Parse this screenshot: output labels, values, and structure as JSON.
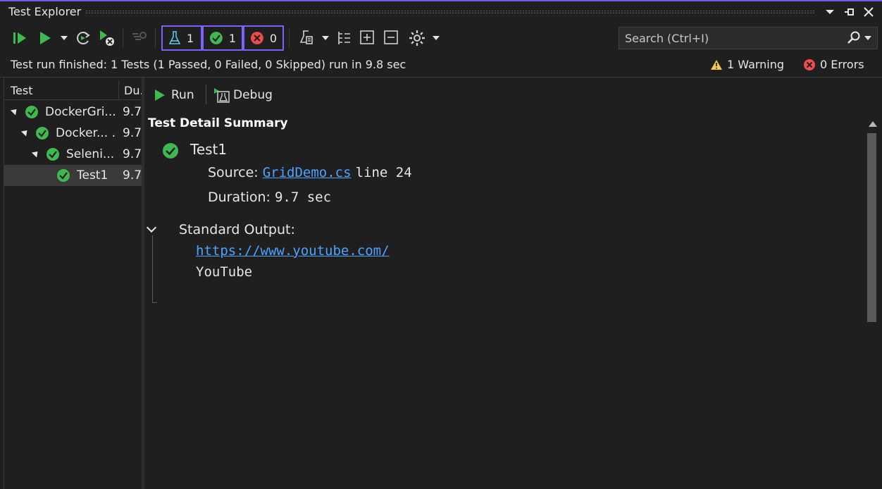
{
  "window": {
    "title": "Test Explorer"
  },
  "toolbar": {
    "counters": [
      {
        "icon": "flask-icon",
        "value": "1"
      },
      {
        "icon": "passed-icon",
        "value": "1"
      },
      {
        "icon": "failed-icon",
        "value": "0"
      }
    ],
    "search_placeholder": "Search (Ctrl+I)"
  },
  "status": {
    "message": "Test run finished: 1 Tests (1 Passed, 0 Failed, 0 Skipped) run in 9.8 sec",
    "warnings": "1 Warning",
    "errors": "0 Errors"
  },
  "tree": {
    "headers": {
      "test": "Test",
      "duration": "Du."
    },
    "rows": [
      {
        "name": "DockerGri...",
        "duration": "9.7",
        "level": 0,
        "selected": false
      },
      {
        "name": "Docker... .",
        "duration": "9.7",
        "level": 1,
        "selected": false
      },
      {
        "name": "Seleni...",
        "duration": "9.7",
        "level": 2,
        "selected": false
      },
      {
        "name": "Test1",
        "duration": "9.7",
        "level": 3,
        "selected": true
      }
    ]
  },
  "detail": {
    "run_label": "Run",
    "debug_label": "Debug",
    "summary_title": "Test Detail Summary",
    "test_name": "Test1",
    "source_label": "Source:",
    "source_file": "GridDemo.cs",
    "source_line": "line 24",
    "duration_label": "Duration:",
    "duration_value": "9.7 sec",
    "standard_output_label": "Standard Output:",
    "output_lines": [
      "https://www.youtube.com/",
      "YouTube"
    ]
  },
  "colors": {
    "accent": "#7b61ff",
    "pass": "#3fb950",
    "fail": "#f14c4c",
    "warning": "#f2c94c",
    "link": "#4da3ff"
  }
}
